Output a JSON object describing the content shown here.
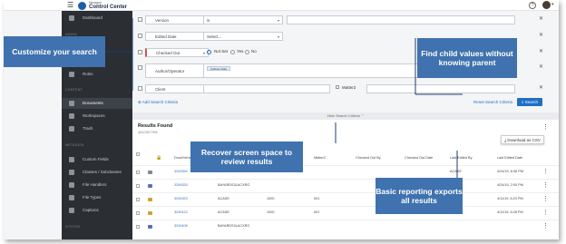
{
  "header": {
    "brand_small": "Hexagon",
    "brand_title": "Control Center",
    "help_icon": "help-circle-icon"
  },
  "sidebar": {
    "sections": [
      "ADMIN",
      "CONTENT",
      "METADATA",
      "SYSTEM"
    ],
    "items": [
      {
        "label": "Dashboard",
        "icon": "dashboard-icon"
      },
      {
        "label": "Roles",
        "icon": "roles-icon"
      },
      {
        "label": "Documents",
        "icon": "document-icon",
        "active": true
      },
      {
        "label": "Workspaces",
        "icon": "workspace-icon"
      },
      {
        "label": "Trash",
        "icon": "trash-icon"
      },
      {
        "label": "Custom Fields",
        "icon": "custom-fields-icon"
      },
      {
        "label": "Classes / Subclasses",
        "icon": "classes-icon"
      },
      {
        "label": "File Handlers",
        "icon": "file-handler-icon"
      },
      {
        "label": "File Types",
        "icon": "file-type-icon"
      },
      {
        "label": "Captions",
        "icon": "captions-icon"
      }
    ]
  },
  "criteria": [
    {
      "field": "Version",
      "operator": "is"
    },
    {
      "field": "Edited Date",
      "operator": "Select..."
    },
    {
      "field": "Checked Out",
      "options": [
        "Not Set",
        "Yes",
        "No"
      ]
    },
    {
      "field": "Author/Operator",
      "value_chip": "Andrew Clark"
    },
    {
      "field": "Client",
      "extra_label": "Matter2"
    }
  ],
  "actions": {
    "add_criteria": "Add Search Criteria",
    "reset_criteria": "Reset Search Criteria",
    "search": "Search",
    "hide_criteria": "Hide Search Criteria"
  },
  "results": {
    "title": "Results Found",
    "count": "@ACME7998",
    "download": "Download as CSV",
    "columns": [
      "Doc#/Version",
      "Client",
      "Matter2",
      "Checked Out By",
      "Checked Out Date",
      "Last Edited By",
      "Last Edited Date"
    ],
    "rows": [
      {
        "doc": "3249332",
        "client": "",
        "matter": "",
        "edited_by": "ACASE",
        "edited_date": "4/24/19, 6:08 PM"
      },
      {
        "doc": "3249333",
        "client": "BAYARDS3LACXRO",
        "matter": "",
        "edited_by": "",
        "edited_date": "4/24/19, 2:00 PM"
      },
      {
        "doc": "3249323",
        "client": "ACASE",
        "matter": "1000",
        "code": "001",
        "edited_by": "ACASE",
        "edited_date": "4/11/19, 6:23 PM"
      },
      {
        "doc": "3249122",
        "client": "ACASE",
        "matter": "1000",
        "code": "001",
        "edited_by": "ACASE",
        "edited_date": "4/11/19, 6:28 PM"
      },
      {
        "doc": "3249108",
        "client": "BAYARDS3LACXRO",
        "matter": "",
        "edited_by": "",
        "edited_date": ""
      }
    ]
  },
  "callouts": {
    "customize": "Customize your search",
    "child_values": "Find child values without knowing parent",
    "recover": "Recover screen space to review results",
    "reporting": "Basic reporting exports all results"
  },
  "colors": {
    "callout": "#3f72ae",
    "sidebar": "#2b2e33",
    "link": "#2d6fc1",
    "primary_button": "#1f6fc5"
  }
}
